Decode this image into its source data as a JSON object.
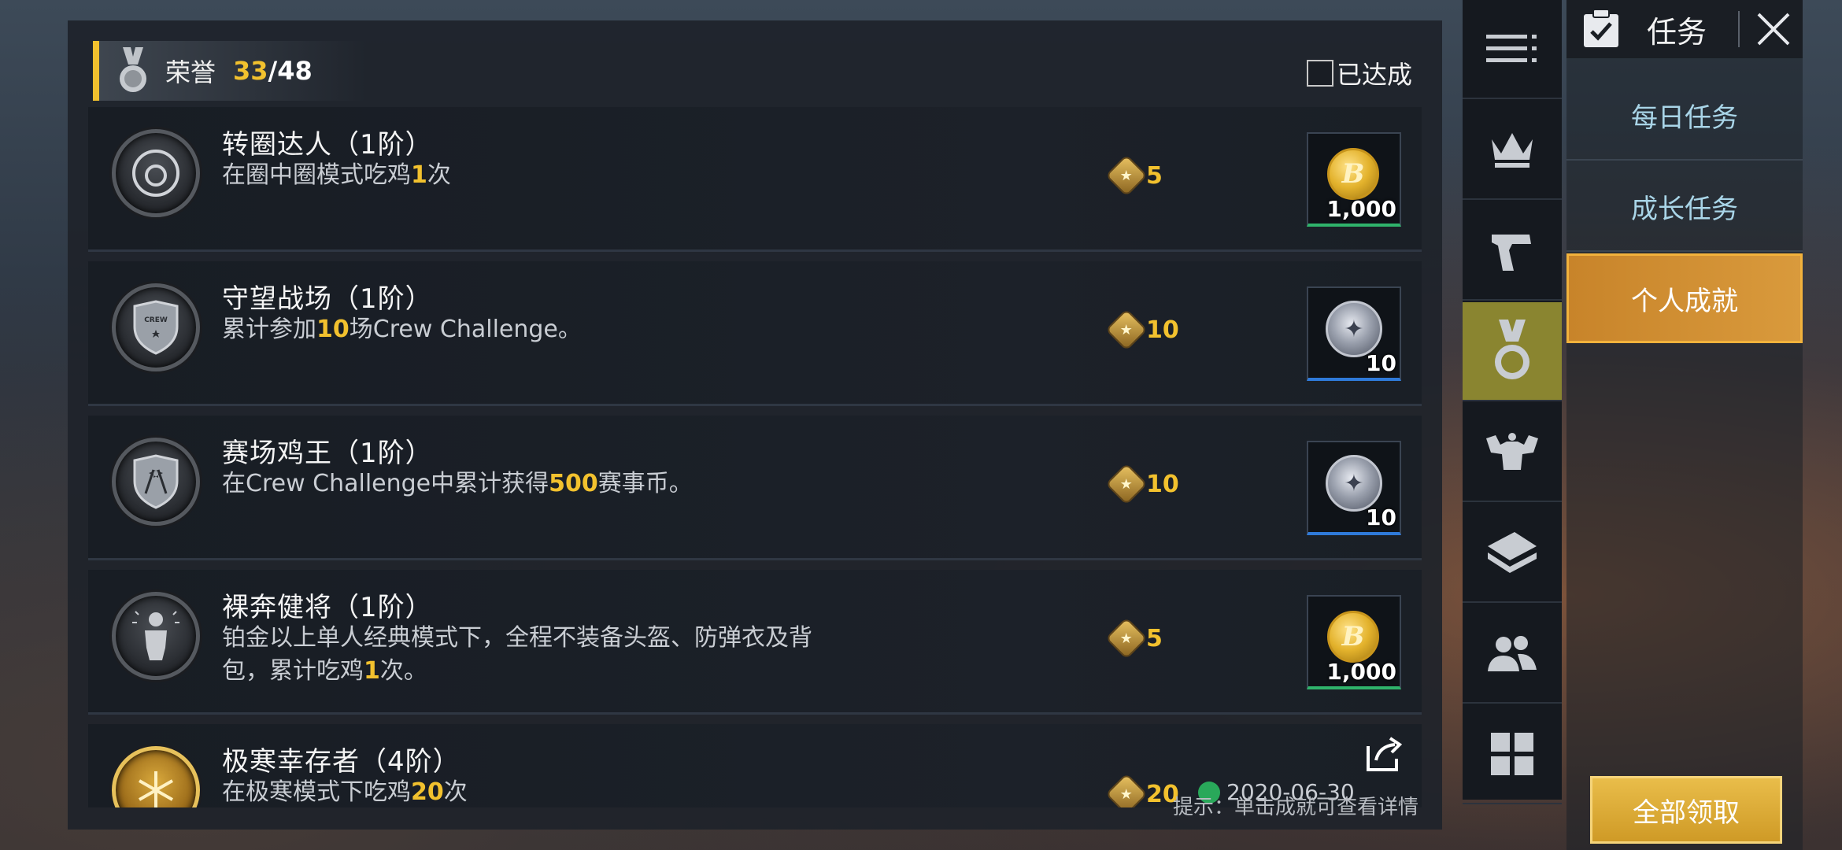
{
  "header": {
    "title": "荣誉",
    "count_current": "33",
    "count_total": "/48",
    "achieved_label": "已达成"
  },
  "achievements": [
    {
      "title": "转圈达人（1阶）",
      "desc_parts": [
        "在圈中圈模式吃鸡",
        "1",
        "次"
      ],
      "points": "5",
      "reward_qty": "1,000",
      "reward_type": "coin"
    },
    {
      "title": "守望战场（1阶）",
      "desc_parts": [
        "累计参加",
        "10",
        "场Crew Challenge。"
      ],
      "points": "10",
      "reward_qty": "10",
      "reward_type": "badge"
    },
    {
      "title": "赛场鸡王（1阶）",
      "desc_parts": [
        "在Crew Challenge中累计获得",
        "500",
        "赛事币。"
      ],
      "points": "10",
      "reward_qty": "10",
      "reward_type": "badge"
    },
    {
      "title": "裸奔健将（1阶）",
      "desc_parts": [
        "铂金以上单人经典模式下，全程不装备头盔、防弹衣及背包，累计吃鸡",
        "1",
        "次。"
      ],
      "points": "5",
      "reward_qty": "1,000",
      "reward_type": "coin"
    },
    {
      "title": "极寒幸存者（4阶）",
      "desc_parts": [
        "在极寒模式下吃鸡",
        "20",
        "次"
      ],
      "points": "20",
      "date": "2020-06-30"
    }
  ],
  "hint": "提示：单击成就可查看详情",
  "side": {
    "title": "任务",
    "tabs": [
      "每日任务",
      "成长任务",
      "个人成就"
    ],
    "active_tab": "个人成就",
    "claim_all": "全部领取"
  },
  "nav_icons": [
    "menu-icon",
    "crown-icon",
    "pistol-icon",
    "medal-icon",
    "muscle-icon",
    "ticket-icon",
    "friends-icon",
    "grid-icon"
  ],
  "colors": {
    "accent": "#f2c12e",
    "active_nav": "#8a8530",
    "active_tab": "#d08f32",
    "tab_text": "#a9d5e8"
  }
}
